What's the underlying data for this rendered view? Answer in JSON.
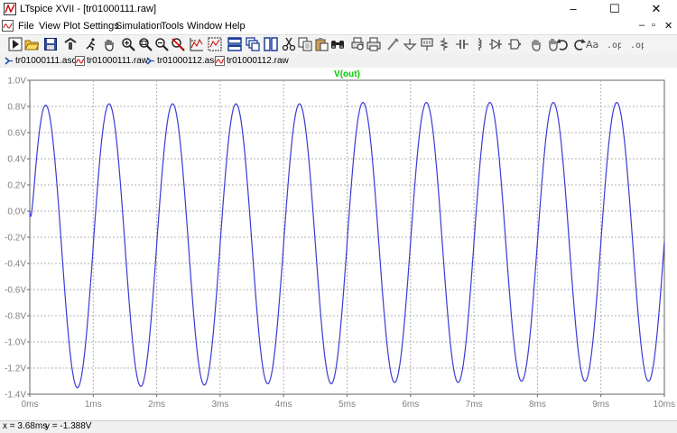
{
  "window": {
    "title": "LTspice XVII - [tr01000111.raw]",
    "minimize": "–",
    "maximize": "☐",
    "close": "✕"
  },
  "menu": {
    "items": [
      "File",
      "View",
      "Plot Settings",
      "Simulation",
      "Tools",
      "Window",
      "Help"
    ],
    "mdi_controls": [
      "–",
      "▫",
      "✕"
    ]
  },
  "toolbar": {
    "icons": [
      "run-icon",
      "open-icon",
      "save-icon",
      "control-panel-icon",
      "run-figure-icon",
      "pan-icon",
      "zoom-in-icon",
      "zoom-area-icon",
      "zoom-out-icon",
      "zoom-cancel-icon",
      "autorange-icon",
      "zoom-fit-icon",
      "tile-horizontal-icon",
      "cascade-icon",
      "tile-vertical-icon",
      "cut-icon",
      "copy-icon",
      "paste-icon",
      "find-icon",
      "print-preview-icon",
      "print-icon",
      "wire-icon",
      "ground-icon",
      "label-net-icon",
      "resistor-icon",
      "capacitor-icon",
      "inductor-icon",
      "diode-icon",
      "component-icon",
      "move-icon",
      "drag-icon",
      "undo-icon",
      "redo-icon",
      "text-icon",
      "spice-directive-icon",
      "spice-op-icon"
    ]
  },
  "tabs": [
    {
      "label": "tr01000111.asc",
      "type": "schematic"
    },
    {
      "label": "tr01000111.raw",
      "type": "waveform",
      "active": true
    },
    {
      "label": "tr01000112.asc",
      "type": "schematic"
    },
    {
      "label": "tr01000112.raw",
      "type": "waveform"
    }
  ],
  "chart_data": {
    "type": "line",
    "title": "V(out)",
    "xlabel": "",
    "ylabel": "",
    "xlim": [
      0,
      10
    ],
    "ylim": [
      -1.4,
      1.0
    ],
    "x_ticks": [
      "0ms",
      "1ms",
      "2ms",
      "3ms",
      "4ms",
      "5ms",
      "6ms",
      "7ms",
      "8ms",
      "9ms",
      "10ms"
    ],
    "y_ticks": [
      "1.0V",
      "0.8V",
      "0.6V",
      "0.4V",
      "0.2V",
      "0.0V",
      "-0.2V",
      "-0.4V",
      "-0.6V",
      "-0.8V",
      "-1.0V",
      "-1.2V",
      "-1.4V"
    ],
    "grid": true,
    "series": [
      {
        "name": "V(out)",
        "color": "#3b3bd6",
        "frequency_khz": 1,
        "peaks_v": [
          0.81,
          0.82,
          0.82,
          0.82,
          0.82,
          0.83,
          0.83,
          0.83,
          0.83,
          0.83
        ],
        "troughs_v": [
          -1.35,
          -1.34,
          -1.33,
          -1.32,
          -1.32,
          -1.31,
          -1.31,
          -1.3,
          -1.3,
          -1.3
        ],
        "start_v": 0.0,
        "end_v": 0.05
      }
    ]
  },
  "status": {
    "x": "x = 3.68ms",
    "y": "y = -1.388V"
  },
  "colors": {
    "title": "#00cc00",
    "trace": "#3b3bd6",
    "grid": "#b0b0b0",
    "axis_text": "#808080"
  }
}
